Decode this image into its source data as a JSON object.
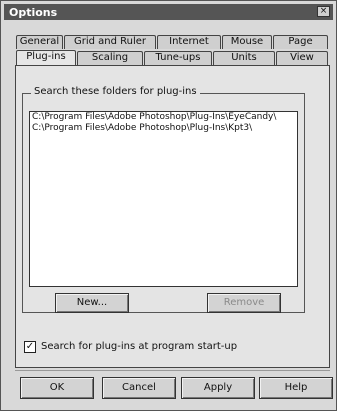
{
  "window": {
    "title": "Options",
    "close_glyph": "×"
  },
  "tabs_row1": [
    "General",
    "Grid and Ruler",
    "Internet",
    "Mouse",
    "Page"
  ],
  "tabs_row2": [
    "Plug-ins",
    "Scaling",
    "Tune-ups",
    "Units",
    "View"
  ],
  "active_tab": "Plug-ins",
  "group": {
    "label": "Search these folders for plug-ins"
  },
  "folders": [
    "C:\\Program Files\\Adobe Photoshop\\Plug-Ins\\EyeCandy\\",
    "C:\\Program Files\\Adobe Photoshop\\Plug-Ins\\Kpt3\\"
  ],
  "buttons": {
    "new": "New...",
    "remove": "Remove"
  },
  "checkbox": {
    "label": "Search for plug-ins at program start-up",
    "checked": true,
    "mark": "✓"
  },
  "footer": {
    "ok": "OK",
    "cancel": "Cancel",
    "apply": "Apply",
    "help": "Help"
  }
}
